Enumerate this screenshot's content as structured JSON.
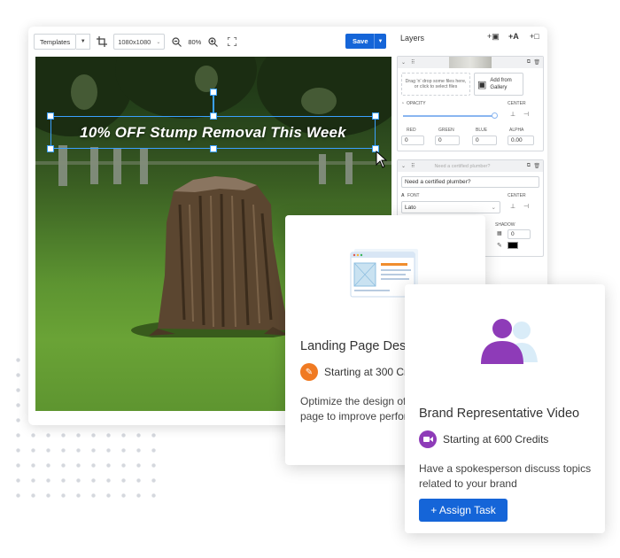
{
  "toolbar": {
    "templates_label": "Templates",
    "size_label": "1080x1080",
    "zoom_label": "80%",
    "save_label": "Save"
  },
  "canvas": {
    "headline": "10% OFF Stump Removal This Week"
  },
  "layers": {
    "title": "Layers",
    "image_layer": {
      "drop_text": "Drag 'n' drop some files here, or click to select files",
      "gallery_label": "Add from Gallery",
      "opacity_label": "OPACITY",
      "center_label": "CENTER",
      "red_label": "RED",
      "green_label": "GREEN",
      "blue_label": "BLUE",
      "alpha_label": "ALPHA",
      "red_value": "0",
      "green_value": "0",
      "blue_value": "0",
      "alpha_value": "0.00"
    },
    "text_layer": {
      "bar_text": "Need a certified plumber?",
      "text_value": "Need a certified plumber?",
      "font_label": "FONT",
      "font_value": "Lato",
      "center_label": "CENTER",
      "shadow_label": "SHADOW",
      "shadow_value": "0"
    }
  },
  "cards": {
    "landing": {
      "title": "Landing Page Des",
      "credits": "Starting at 300 Cr",
      "desc_line1": "Optimize the design of",
      "desc_line2": "page to improve perfor"
    },
    "brand": {
      "title": "Brand Representative Video",
      "credits": "Starting at 600 Credits",
      "desc_line1": "Have a spokesperson discuss topics",
      "desc_line2": "related to your brand",
      "button_label": "+ Assign Task"
    }
  },
  "colors": {
    "accent": "#1565d8",
    "selection": "#3aa0ff",
    "landing_badge": "#f07a22",
    "brand_badge": "#8e3bb8"
  }
}
